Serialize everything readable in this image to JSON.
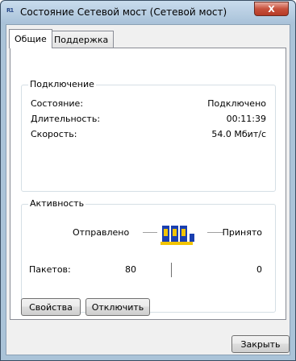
{
  "window": {
    "title": "Состояние Сетевой мост (Сетевой мост)",
    "close_glyph": "X",
    "title_icon_text": "R1"
  },
  "tabs": [
    {
      "label": "Общие",
      "active": true
    },
    {
      "label": "Поддержка",
      "active": false
    }
  ],
  "connection": {
    "group_label": "Подключение",
    "rows": [
      {
        "label": "Состояние:",
        "value": "Подключено"
      },
      {
        "label": "Длительность:",
        "value": "00:11:39"
      },
      {
        "label": "Скорость:",
        "value": "54.0 Мбит/с"
      }
    ]
  },
  "activity": {
    "group_label": "Активность",
    "sent_label": "Отправлено",
    "received_label": "Принято",
    "packets_label": "Пакетов:",
    "packets_sent": "80",
    "packets_received": "0",
    "icon": "network-activity-icon"
  },
  "buttons": {
    "properties": "Свойства",
    "disable": "Отключить",
    "close": "Закрыть"
  },
  "colors": {
    "title_bar": "#a9c2d9",
    "close_button": "#c7503c",
    "icon_blue": "#1a3fb0",
    "icon_yellow": "#f2c400"
  }
}
